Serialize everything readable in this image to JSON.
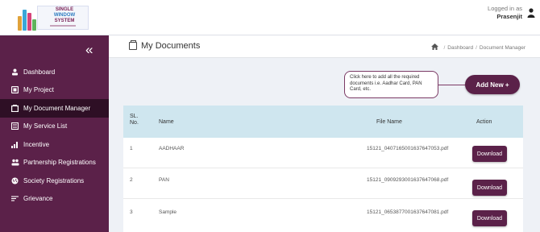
{
  "header": {
    "logo_lines": [
      "SINGLE",
      "WINDOW",
      "SYSTEM"
    ],
    "logged_in_text": "Logged in as",
    "user_name": "Prasenjit"
  },
  "sidebar": {
    "collapse_symbol": "«",
    "items": [
      {
        "label": "Dashboard",
        "icon": "dashboard-icon",
        "active": false
      },
      {
        "label": "My Project",
        "icon": "project-icon",
        "active": false
      },
      {
        "label": "My Document Manager",
        "icon": "document-icon",
        "active": true
      },
      {
        "label": "My Service List",
        "icon": "list-icon",
        "active": false
      },
      {
        "label": "Incentive",
        "icon": "bar-chart-icon",
        "active": false
      },
      {
        "label": "Partnership Registrations",
        "icon": "users-icon",
        "active": false
      },
      {
        "label": "Society Registrations",
        "icon": "globe-icon",
        "active": false
      },
      {
        "label": "Grievance",
        "icon": "filter-list-icon",
        "active": false
      }
    ]
  },
  "page": {
    "title": "My Documents",
    "breadcrumb": [
      "Dashboard",
      "Document Manager"
    ],
    "breadcrumb_sep": "/",
    "hint": "Click here to add all the required documents i.e. Aadhar Card, PAN Card, etc.",
    "add_button": "Add New +"
  },
  "table": {
    "headers": {
      "sl": "SL.\nNo.",
      "name": "Name",
      "file": "File Name",
      "action": "Action"
    },
    "rows": [
      {
        "sl": "1",
        "name": "AADHAAR",
        "file": "15121_04071650016376470​53.pdf",
        "action": "Download"
      },
      {
        "sl": "2",
        "name": "PAN",
        "file": "15121_0909293001637647068.pdf",
        "action": "Download"
      },
      {
        "sl": "3",
        "name": "Sample",
        "file": "15121_0653877001637647081.pdf",
        "action": "Download"
      }
    ]
  },
  "colors": {
    "primary": "#5b2149",
    "active": "#2e0f25",
    "table_head": "#cfe6ef",
    "background": "#eef1f6"
  }
}
